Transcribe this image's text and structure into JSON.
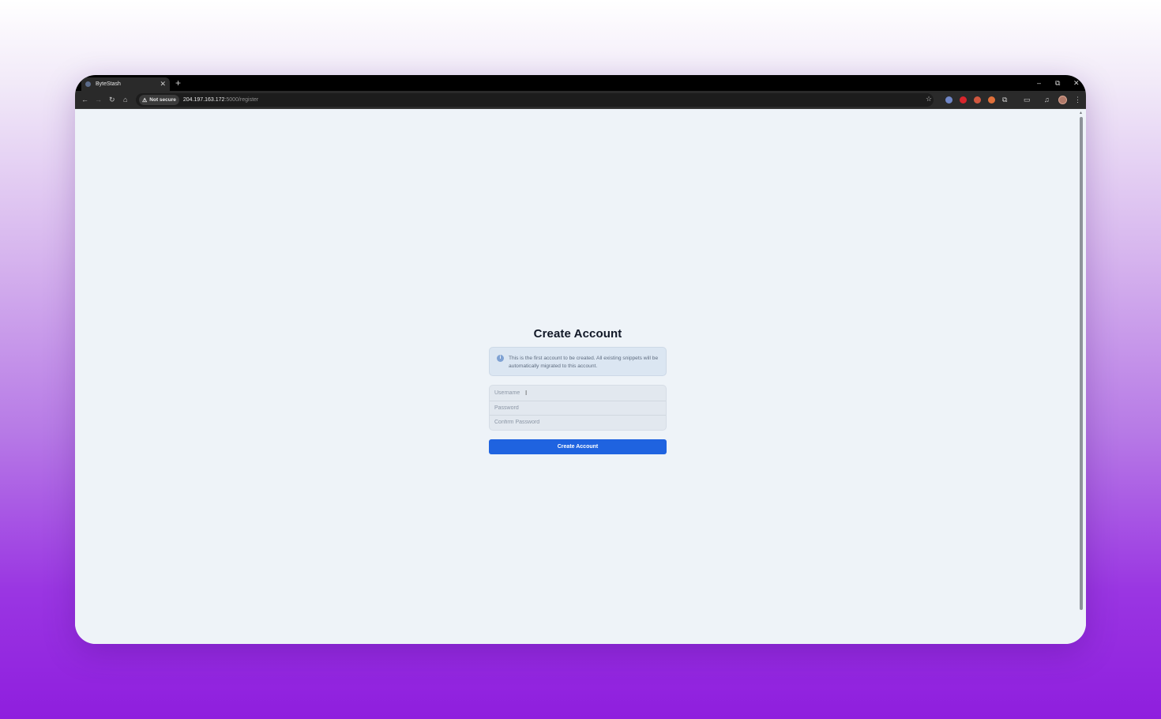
{
  "browser": {
    "tab": {
      "title": "ByteStash",
      "close_glyph": "✕"
    },
    "new_tab_glyph": "+",
    "window_controls": {
      "minimize": "–",
      "restore": "⧉",
      "close": "✕"
    },
    "nav": {
      "back": "←",
      "forward": "→",
      "reload": "↻",
      "home": "⌂"
    },
    "security_label": "Not secure",
    "security_icon": "⚠",
    "url": {
      "host": "204.197.163.172",
      "path": ":5000/register"
    },
    "bookmark_icon": "☆",
    "extension_colors": [
      "#6f86c7",
      "#d8252c",
      "#d0573f",
      "#e0703a"
    ],
    "toolbar_icons": {
      "extensions": "⧉",
      "sidepanel": "▭",
      "media": "♫",
      "menu": "⋮"
    }
  },
  "page": {
    "title": "Create Account",
    "notice": {
      "icon": "i",
      "text": "This is the first account to be created. All existing snippets will be automatically migrated to this account."
    },
    "fields": {
      "username_placeholder": "Username",
      "password_placeholder": "Password",
      "confirm_placeholder": "Confirm Password"
    },
    "submit_label": "Create Account"
  },
  "colors": {
    "accent": "#1f63e0",
    "page_bg": "#eef3f8",
    "notice_bg": "#dbe6f2"
  }
}
